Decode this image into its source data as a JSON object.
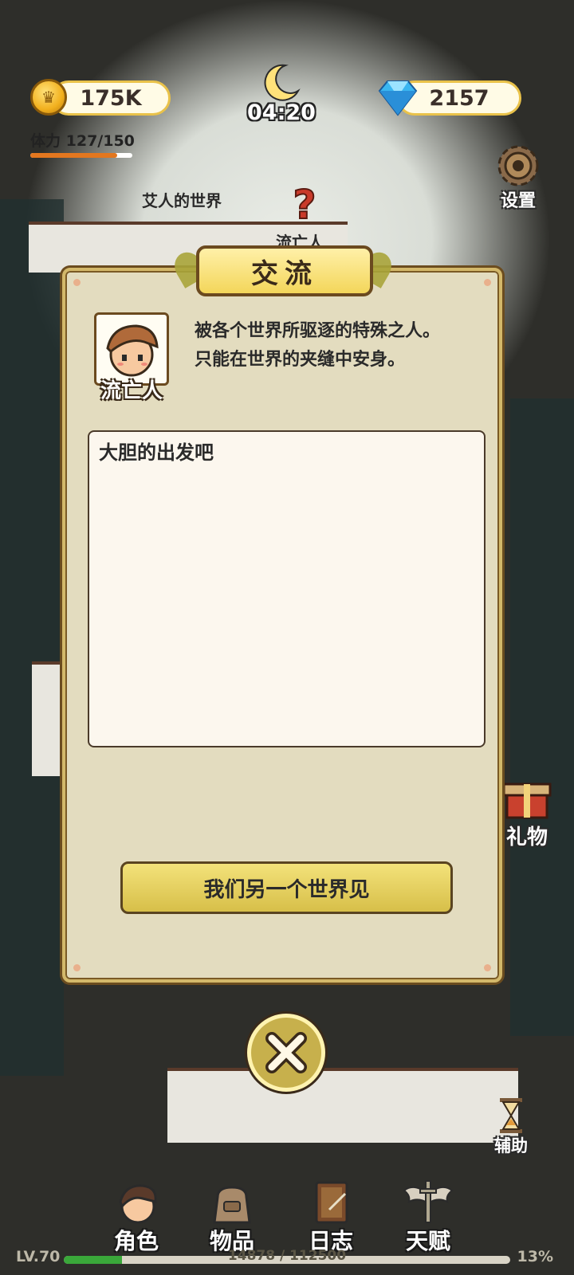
{
  "header": {
    "gold": "175K",
    "gems": "2157",
    "stamina_label": "体力",
    "stamina_value": "127/150",
    "stamina_fraction": 0.85,
    "time": "04:20",
    "settings_label": "设置"
  },
  "map": {
    "world_label": "艾人的世界",
    "npc_label": "流亡人"
  },
  "side": {
    "gift_label": "礼物",
    "assist_label": "辅助"
  },
  "dialog": {
    "title": "交流",
    "npc_name": "流亡人",
    "description_line1": "被各个世界所驱逐的特殊之人。",
    "description_line2": "只能在世界的夹缝中安身。",
    "message": "大胆的出发吧",
    "reply_button": "我们另一个世界见"
  },
  "nav": {
    "items": [
      {
        "label": "角色",
        "icon": "character-icon"
      },
      {
        "label": "物品",
        "icon": "bag-icon"
      },
      {
        "label": "日志",
        "icon": "journal-icon"
      },
      {
        "label": "天赋",
        "icon": "talent-icon"
      }
    ]
  },
  "xp": {
    "level": "LV.70",
    "progress": "14878 / 112500",
    "percent": "13%",
    "fraction": 0.13
  },
  "colors": {
    "gold": "#f2b01e",
    "panel": "#e3dcbf",
    "button": "#e6d15f",
    "xp_fill": "#3aa83a",
    "stamina_fill": "#e3771f"
  }
}
